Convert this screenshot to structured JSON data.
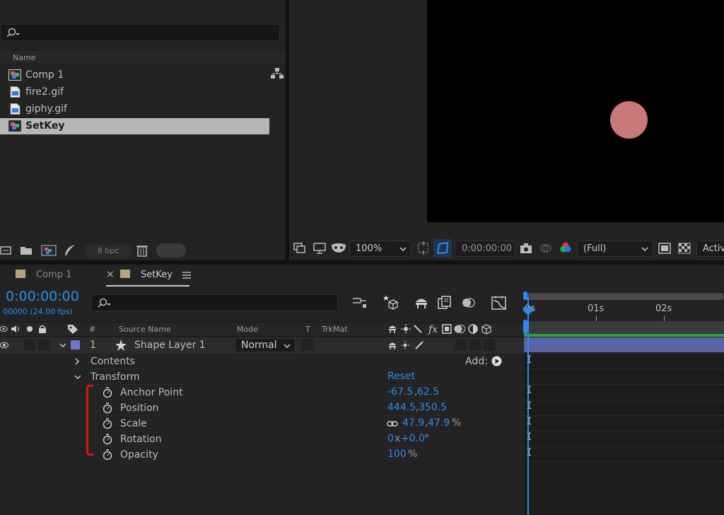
{
  "project_panel": {
    "column_header": "Name",
    "items": [
      {
        "label": "Comp 1",
        "type": "composition"
      },
      {
        "label": "fire2.gif",
        "type": "footage"
      },
      {
        "label": "giphy.gif",
        "type": "footage"
      },
      {
        "label": "SetKey",
        "type": "composition",
        "selected": true
      }
    ],
    "bit_depth": "8 bpc"
  },
  "viewer": {
    "zoom": "100%",
    "timecode": "0:00:00:00",
    "resolution": "(Full)",
    "camera": "Activ",
    "shape_color": "#c97878"
  },
  "timeline": {
    "tabs": [
      {
        "label": "Comp 1"
      },
      {
        "label": "SetKey",
        "active": true
      }
    ],
    "current_time": "0:00:00:00",
    "frame_rate": "00000 (24.00 fps)",
    "columns": {
      "number": "#",
      "source_name": "Source Name",
      "mode": "Mode",
      "t": "T",
      "trkmat": "TrkMat"
    },
    "layer": {
      "number": "1",
      "name": "Shape Layer 1",
      "mode": "Normal",
      "label_color": "#7077c9"
    },
    "contents_label": "Contents",
    "add_label": "Add:",
    "transform_label": "Transform",
    "reset_label": "Reset",
    "properties": {
      "anchor_point": {
        "label": "Anchor Point",
        "v1": "-67.5",
        "v2": "62.5"
      },
      "position": {
        "label": "Position",
        "v1": "444.5",
        "v2": "350.5"
      },
      "scale": {
        "label": "Scale",
        "v1": "47.9",
        "v2": "47.9",
        "unit": "%"
      },
      "rotation": {
        "label": "Rotation",
        "v1": "0",
        "mid": "x",
        "v2": "+0.0",
        "unit": "°"
      },
      "opacity": {
        "label": "Opacity",
        "v1": "100",
        "unit": "%"
      }
    },
    "ruler": [
      "0s",
      "01s",
      "02s"
    ],
    "accent_color": "#2d8ceb"
  }
}
